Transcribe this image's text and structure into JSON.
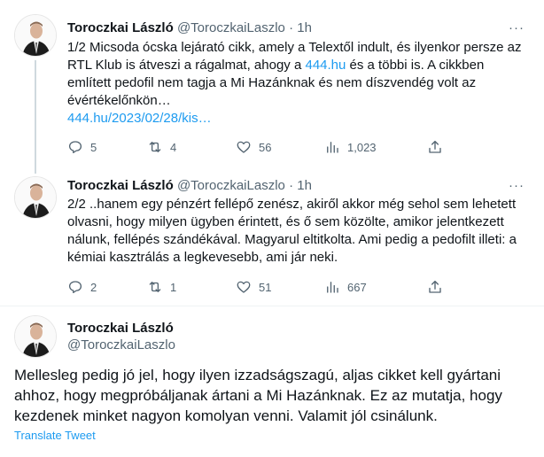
{
  "tweets": [
    {
      "name": "Toroczkai László",
      "handle": "@ToroczkaiLaszlo",
      "separator": "·",
      "time": "1h",
      "more": "···",
      "text_pre": "1/2 Micsoda ócska lejárató cikk, amely a Telextől indult, és ilyenkor persze az RTL Klub is átveszi a rágalmat, ahogy a ",
      "text_link": "444.hu",
      "text_post": " és a többi is. A cikkben említett pedofil nem tagja a Mi Hazánknak és nem díszvendég volt az évértékelőnkön…",
      "url": "444.hu/2023/02/28/kis…",
      "replies": "5",
      "retweets": "4",
      "likes": "56",
      "views": "1,023"
    },
    {
      "name": "Toroczkai László",
      "handle": "@ToroczkaiLaszlo",
      "separator": "·",
      "time": "1h",
      "more": "···",
      "text": "2/2 ..hanem egy pénzért fellépő zenész, akiről akkor még sehol sem lehetett olvasni, hogy milyen ügyben érintett, és ő sem közölte, amikor jelentkezett nálunk, fellépés szándékával. Magyarul eltitkolta. Ami pedig a pedofilt illeti: a kémiai kasztrálás a legkevesebb, ami jár neki.",
      "replies": "2",
      "retweets": "1",
      "likes": "51",
      "views": "667"
    }
  ],
  "main_tweet": {
    "name": "Toroczkai László",
    "handle": "@ToroczkaiLaszlo",
    "text": "Mellesleg pedig jó jel, hogy ilyen izzadságszagú, aljas cikket kell gyártani ahhoz, hogy megpróbáljanak ártani a Mi Hazánknak. Ez az mutatja, hogy kezdenek minket nagyon komolyan venni. Valamit jól csinálunk.",
    "translate": "Translate Tweet"
  },
  "colors": {
    "text": "#0f1419",
    "secondary": "#536471",
    "link": "#1d9bf0",
    "thread_line": "#cfd9de"
  },
  "icons": [
    "reply-icon",
    "retweet-icon",
    "like-icon",
    "views-icon",
    "share-icon",
    "more-icon"
  ]
}
